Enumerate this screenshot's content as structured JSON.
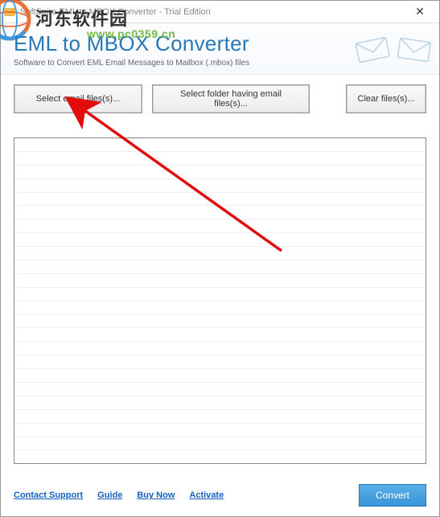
{
  "window_title": "SoftSpire EML to MBOX Converter - Trial Edition",
  "header": {
    "title": "EML to MBOX Converter",
    "subtitle": "Software to Convert EML Email Messages to Mailbox (.mbox) files"
  },
  "buttons": {
    "select_files": "Select email files(s)...",
    "select_folder": "Select folder having email files(s)...",
    "clear": "Clear files(s)..."
  },
  "footer": {
    "contact": "Contact Support",
    "guide": "Guide",
    "buy": "Buy Now",
    "activate": "Activate",
    "convert": "Convert"
  },
  "watermark": {
    "site": "河东软件园",
    "url": "www.pc0359.cn"
  }
}
